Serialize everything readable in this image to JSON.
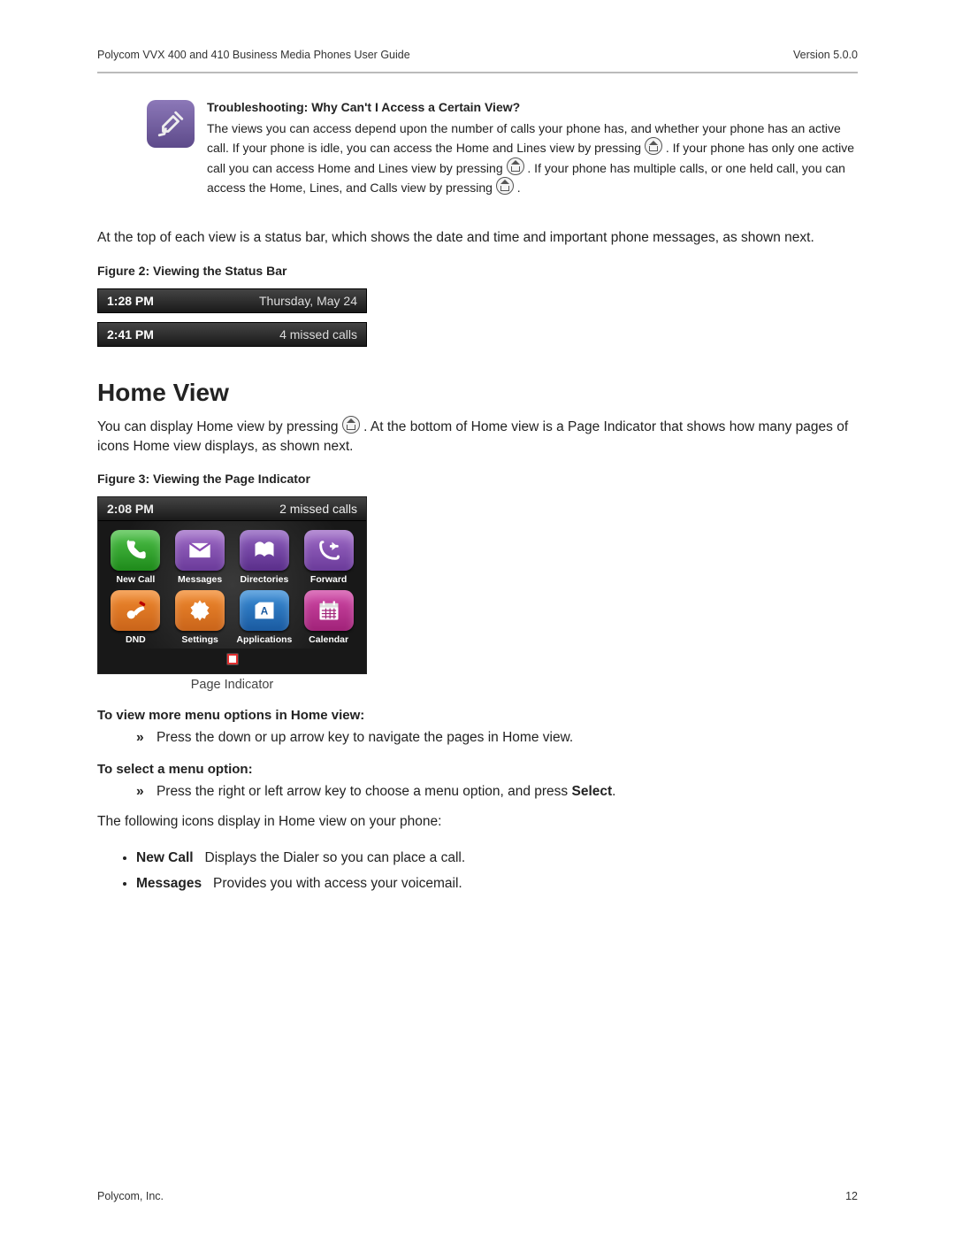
{
  "header": {
    "doc_title": "Polycom VVX 400 and 410 Business Media Phones User Guide",
    "version": "Version 5.0.0"
  },
  "trouble": {
    "title": "Troubleshooting: Why Can't I Access a Certain View?",
    "t1": "The views you can access depend upon the number of calls your phone has, and whether your phone has an active call. If your phone is idle, you can access the Home and Lines view by pressing ",
    "t2": ". If your phone has only one active call you can access Home and Lines view by pressing ",
    "t3": ". If your phone has multiple calls, or one held call, you can access the Home, Lines, and Calls view by pressing ",
    "t4": "."
  },
  "body_top": "At the top of each view is a status bar, which shows the date and time and important phone messages, as shown next.",
  "fig2": {
    "caption": "Figure 2: Viewing the Status Bar",
    "bars": [
      {
        "time": "1:28 PM",
        "right": "Thursday, May 24"
      },
      {
        "time": "2:41 PM",
        "right": "4 missed calls"
      }
    ]
  },
  "home": {
    "heading": "Home View",
    "p1a": "You can display Home view by pressing ",
    "p1b": ". At the bottom of Home view is a Page Indicator that shows how many pages of icons Home view displays, as shown next."
  },
  "fig3": {
    "caption": "Figure 3: Viewing the Page Indicator",
    "status": {
      "time": "2:08 PM",
      "right": "2 missed calls"
    },
    "apps": [
      {
        "label": "New Call",
        "color": "g-green"
      },
      {
        "label": "Messages",
        "color": "g-purple"
      },
      {
        "label": "Directories",
        "color": "g-purple2"
      },
      {
        "label": "Forward",
        "color": "g-purple"
      },
      {
        "label": "DND",
        "color": "g-orange"
      },
      {
        "label": "Settings",
        "color": "g-orange"
      },
      {
        "label": "Applications",
        "color": "g-blue"
      },
      {
        "label": "Calendar",
        "color": "g-mag"
      }
    ],
    "page_indicator_label": "Page Indicator"
  },
  "instr": {
    "h1": "To view more menu options in Home view:",
    "h1_item": "Press the down or up arrow key to navigate the pages in Home view.",
    "h2": "To select a menu option:",
    "h2_item_a": "Press the right or left arrow key to choose a menu option, and press ",
    "h2_item_b": "Select",
    "h2_item_c": "."
  },
  "following": "The following icons display in Home view on your phone:",
  "icon_list": [
    {
      "name": "New Call",
      "desc": "Displays the Dialer so you can place a call."
    },
    {
      "name": "Messages",
      "desc": "Provides you with access your voicemail."
    }
  ],
  "footer": {
    "left": "Polycom, Inc.",
    "page": "12"
  }
}
